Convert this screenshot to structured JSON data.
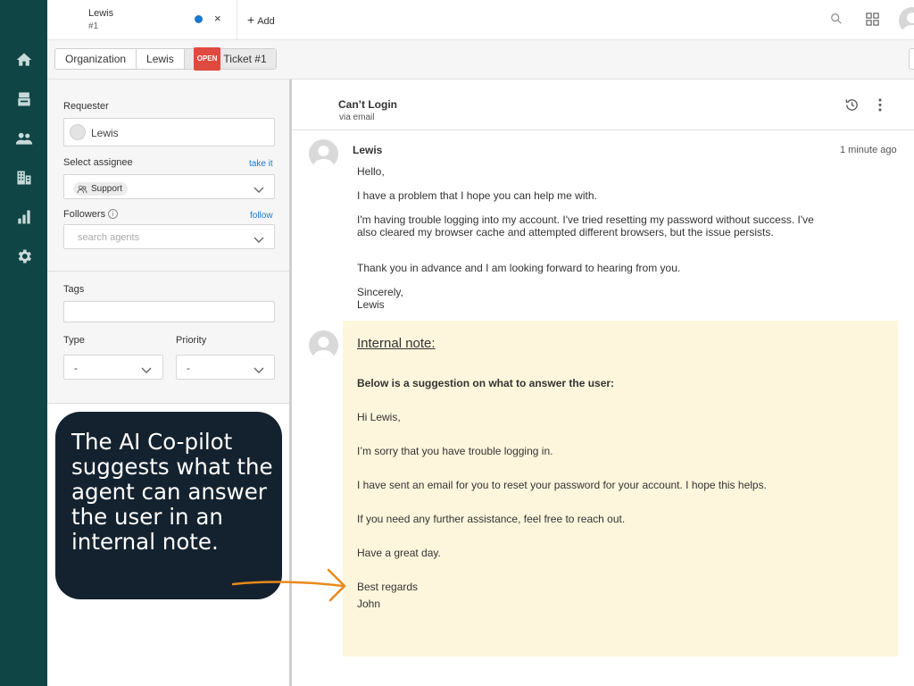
{
  "tab": {
    "title": "Lewis",
    "subtitle": "#1",
    "close": "×"
  },
  "add_button": "Add",
  "breadcrumb": {
    "items": [
      "Organization",
      "Lewis"
    ],
    "badge": "OPEN",
    "current": "Ticket #1"
  },
  "sidebar": {
    "requester_label": "Requester",
    "requester_value": "Lewis",
    "assignee_label": "Select assignee",
    "assignee_link": "take it",
    "assignee_value": "Support",
    "followers_label": "Followers",
    "followers_link": "follow",
    "followers_placeholder": "search agents",
    "tags_label": "Tags",
    "type_label": "Type",
    "type_value": "-",
    "priority_label": "Priority",
    "priority_value": "-"
  },
  "callout": "The AI Co-pilot suggests what the agent can answer the user in an internal note.",
  "conversation": {
    "title": "Can’t Login",
    "subtitle": "via email",
    "message": {
      "author": "Lewis",
      "time": "1 minute ago",
      "greeting": "Hello,",
      "p1": "I have a problem that I hope you can help me with.",
      "p2a": "I'm having trouble logging into my account. I've tried resetting my password without success. I've",
      "p2b": "also cleared my browser cache and attempted different browsers, but the issue persists.",
      "p3": "Thank you in advance and I am looking forward to hearing from you.",
      "closing": "Sincerely,",
      "signature": "Lewis"
    },
    "note": {
      "title": "Internal note:",
      "intro": "Below is a suggestion on what to answer the user:",
      "l1": "Hi Lewis,",
      "l2": "I’m sorry that you have trouble logging in.",
      "l3": "I have sent an email for you to reset your password for your account. I hope this helps.",
      "l4": "If you need any further assistance, feel free to reach out.",
      "l5": "Have a great day.",
      "l6": "Best regards",
      "l7": "John"
    }
  },
  "colors": {
    "nav_bg": "#0f4545",
    "badge": "#e0493e",
    "link": "#1f77d0",
    "note_bg": "#fef6dc",
    "callout_bg": "#14222f",
    "arrow": "#e8891a"
  }
}
